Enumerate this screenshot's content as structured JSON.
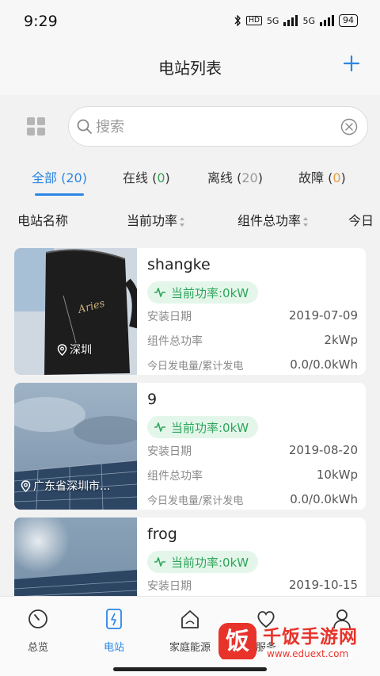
{
  "status_bar": {
    "time": "9:29",
    "hd_label": "HD",
    "sig1_label": "5G",
    "sig2_label": "5G",
    "battery": "94"
  },
  "header": {
    "title": "电站列表"
  },
  "search": {
    "placeholder": "搜索"
  },
  "tabs": [
    {
      "label": "全部",
      "count": "20",
      "active": true
    },
    {
      "label": "在线",
      "count": "0"
    },
    {
      "label": "离线",
      "count": "20"
    },
    {
      "label": "故障",
      "count": "0"
    }
  ],
  "columns": [
    "电站名称",
    "当前功率",
    "组件总功率",
    "今日"
  ],
  "stations": [
    {
      "name": "shangke",
      "location": "深圳",
      "power_pill": "当前功率:0kW",
      "install_label": "安装日期",
      "install_date": "2019-07-09",
      "capacity_label": "组件总功率",
      "capacity": "2kWp",
      "energy_label": "今日发电量/累计发电",
      "energy": "0.0/0.0kWh"
    },
    {
      "name": "9",
      "location": "广东省深圳市...",
      "power_pill": "当前功率:0kW",
      "install_label": "安装日期",
      "install_date": "2019-08-20",
      "capacity_label": "组件总功率",
      "capacity": "10kWp",
      "energy_label": "今日发电量/累计发电",
      "energy": "0.0/0.0kWh"
    },
    {
      "name": "frog",
      "location": "",
      "power_pill": "当前功率:0kW",
      "install_label": "安装日期",
      "install_date": "2019-10-15",
      "capacity_label": "组件总功率",
      "capacity": "",
      "energy_label": "",
      "energy": ""
    }
  ],
  "bottom_nav": [
    {
      "label": "总览",
      "icon": "dial-icon"
    },
    {
      "label": "电站",
      "icon": "station-icon",
      "active": true
    },
    {
      "label": "家庭能源",
      "icon": "home-energy-icon"
    },
    {
      "label": "服务",
      "icon": "service-heart-icon"
    },
    {
      "label": "",
      "icon": "user-icon"
    }
  ],
  "watermark": {
    "logo_char": "饭",
    "text": "千饭手游网",
    "url": "www.eduext.com"
  },
  "colors": {
    "accent": "#2a86e6",
    "online_green": "#37a456",
    "fault_orange": "#e7a040",
    "pill_bg": "#e4f6ea"
  }
}
